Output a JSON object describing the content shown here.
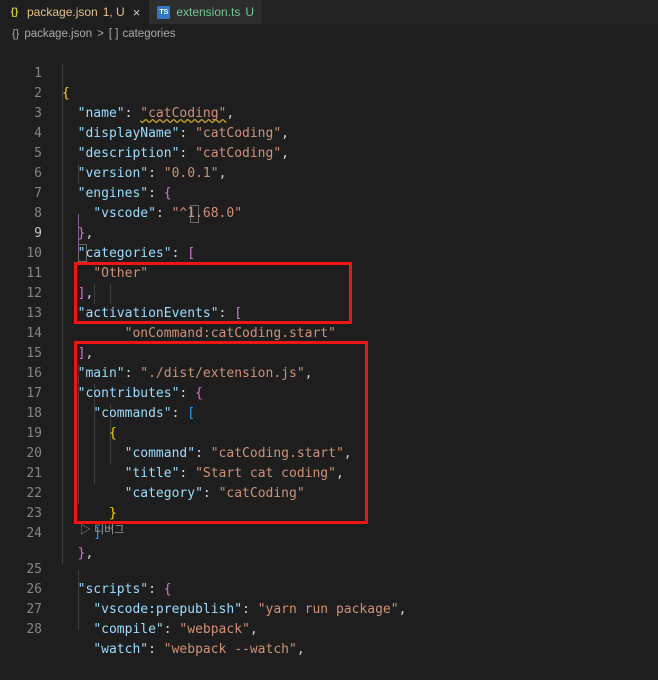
{
  "tabs": [
    {
      "label": "package.json",
      "status": "1, U",
      "close": "×",
      "icon": "json-file-icon",
      "active": true
    },
    {
      "label": "extension.ts",
      "status": "U",
      "icon": "typescript-file-icon",
      "icon_text": "TS",
      "active": false
    }
  ],
  "breadcrumb": {
    "file": "package.json",
    "separator": ">",
    "symbol_icon": "[ ]",
    "symbol": "categories"
  },
  "codelens": {
    "label": "디버그",
    "icon": "play-icon"
  },
  "lines": [
    {
      "n": "1"
    },
    {
      "n": "2"
    },
    {
      "n": "3"
    },
    {
      "n": "4"
    },
    {
      "n": "5"
    },
    {
      "n": "6"
    },
    {
      "n": "7"
    },
    {
      "n": "8"
    },
    {
      "n": "9"
    },
    {
      "n": "10"
    },
    {
      "n": "11"
    },
    {
      "n": "12"
    },
    {
      "n": "13"
    },
    {
      "n": "14"
    },
    {
      "n": "15"
    },
    {
      "n": "16"
    },
    {
      "n": "17"
    },
    {
      "n": "18"
    },
    {
      "n": "19"
    },
    {
      "n": "20"
    },
    {
      "n": "21"
    },
    {
      "n": "22"
    },
    {
      "n": "23"
    },
    {
      "n": "24"
    },
    {
      "n": "25"
    },
    {
      "n": "26"
    },
    {
      "n": "27"
    },
    {
      "n": "28"
    }
  ],
  "tokens": {
    "name_key": "\"name\"",
    "name_val": "\"catCoding\"",
    "displayName_key": "\"displayName\"",
    "displayName_val": "\"catCoding\"",
    "description_key": "\"description\"",
    "description_val": "\"catCoding\"",
    "version_key": "\"version\"",
    "version_val": "\"0.0.1\"",
    "engines_key": "\"engines\"",
    "vscode_key": "\"vscode\"",
    "vscode_val": "\"^1.68.0\"",
    "categories_key": "\"categories\"",
    "other_val": "\"Other\"",
    "activation_key": "\"activationEvents\"",
    "activation_val": "\"onCommand:catCoding.start\"",
    "main_key": "\"main\"",
    "main_val": "\"./dist/extension.js\"",
    "contributes_key": "\"contributes\"",
    "commands_key": "\"commands\"",
    "command_key": "\"command\"",
    "command_val": "\"catCoding.start\"",
    "title_key": "\"title\"",
    "title_val": "\"Start cat coding\"",
    "category_key": "\"category\"",
    "category_val": "\"catCoding\"",
    "scripts_key": "\"scripts\"",
    "prepublish_key": "\"vscode:prepublish\"",
    "prepublish_val": "\"yarn run package\"",
    "compile_key": "\"compile\"",
    "compile_val": "\"webpack\"",
    "watch_key": "\"watch\"",
    "watch_val": "\"webpack --watch\""
  },
  "colors": {
    "editor_bg": "#1e1e1e",
    "key": "#9cdcfe",
    "string": "#ce9178",
    "bracket_gold": "#ffd700",
    "bracket_orchid": "#da70d6",
    "bracket_blue": "#179fff",
    "annotation_red": "#f01414"
  }
}
